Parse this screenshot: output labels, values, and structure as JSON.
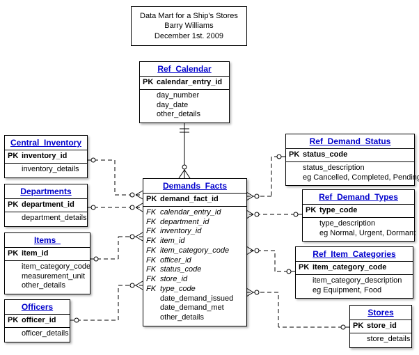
{
  "title": {
    "line1": "Data Mart for a Ship's Stores",
    "line2": "Barry Williams",
    "line3": "December 1st. 2009"
  },
  "entities": {
    "ref_calendar": {
      "title": "Ref_Calendar",
      "pk": "calendar_entry_id",
      "attrs": [
        "day_number",
        "day_date",
        "other_details"
      ]
    },
    "central_inventory": {
      "title": "Central_Inventory",
      "pk": "inventory_id",
      "attrs": [
        "inventory_details"
      ]
    },
    "departments": {
      "title": "Departments",
      "pk": "department_id",
      "attrs": [
        "department_details"
      ]
    },
    "items": {
      "title": "Items_",
      "pk": "item_id",
      "attrs": [
        "item_category_code",
        "measurement_unit",
        "other_details"
      ]
    },
    "officers": {
      "title": "Officers",
      "pk": "officer_id",
      "attrs": [
        "officer_details"
      ]
    },
    "demands_facts": {
      "title": "Demands_Facts",
      "pk": "demand_fact_id",
      "fks": [
        "calendar_entry_id",
        "department_id",
        "inventory_id",
        "item_id",
        "item_category_code",
        "officer_id",
        "status_code",
        "store_id",
        "type_code"
      ],
      "attrs": [
        "date_demand_issued",
        "date_demand_met",
        "other_details"
      ]
    },
    "ref_demand_status": {
      "title": "Ref_Demand_Status",
      "pk": "status_code",
      "attrs": [
        "status_description",
        "eg Cancelled, Completed, Pending"
      ]
    },
    "ref_demand_types": {
      "title": "Ref_Demand_Types",
      "pk": "type_code",
      "attrs": [
        "type_description",
        "eg Normal, Urgent, Dormant"
      ]
    },
    "ref_item_categories": {
      "title": "Ref_Item_Categories",
      "pk": "item_category_code",
      "attrs": [
        "item_category_description",
        "eg Equipment, Food"
      ]
    },
    "stores": {
      "title": "Stores",
      "pk": "store_id",
      "attrs": [
        "store_details"
      ]
    }
  }
}
